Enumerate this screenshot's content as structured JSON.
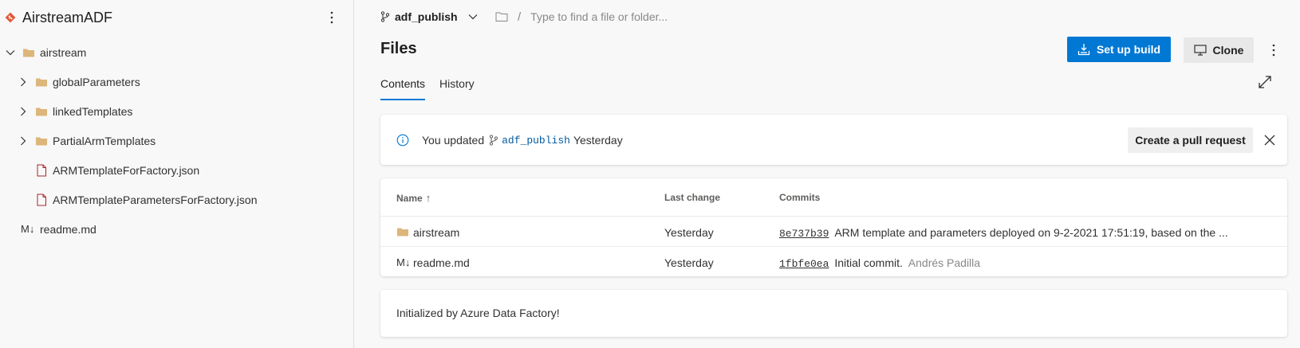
{
  "repo": {
    "name": "AirstreamADF"
  },
  "tree": {
    "root": "airstream",
    "folders": [
      "globalParameters",
      "linkedTemplates",
      "PartialArmTemplates"
    ],
    "files": [
      "ARMTemplateForFactory.json",
      "ARMTemplateParametersForFactory.json"
    ],
    "root_file": "readme.md",
    "md_prefix": "M↓"
  },
  "toolbar": {
    "branch": "adf_publish",
    "path_placeholder": "Type to find a file or folder...",
    "slash": "/"
  },
  "page": {
    "title": "Files",
    "setup_build_label": "Set up build",
    "clone_label": "Clone",
    "tabs": [
      {
        "label": "Contents",
        "active": true
      },
      {
        "label": "History",
        "active": false
      }
    ]
  },
  "banner": {
    "prefix": "You updated",
    "branch": "adf_publish",
    "suffix": "Yesterday",
    "pr_button": "Create a pull request"
  },
  "table": {
    "headers": {
      "name": "Name",
      "last_change": "Last change",
      "commits": "Commits"
    },
    "sort_indicator": "↑",
    "rows": [
      {
        "name": "airstream",
        "last_change": "Yesterday",
        "hash": "8e737b39",
        "message": "ARM template and parameters deployed on 9-2-2021 17:51:19, based on the ...",
        "author": ""
      },
      {
        "name": "readme.md",
        "last_change": "Yesterday",
        "hash": "1fbfe0ea",
        "message": "Initial commit.",
        "author": "Andrés Padilla"
      }
    ]
  },
  "readme": {
    "text": "Initialized by Azure Data Factory!"
  },
  "colors": {
    "accent": "#0078d4",
    "folder": "#dcb67a",
    "git_logo": "#e05735"
  }
}
